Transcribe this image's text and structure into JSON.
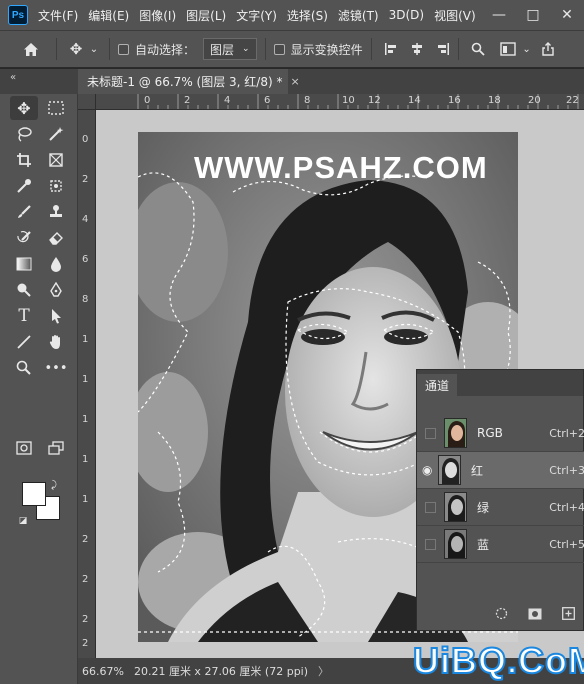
{
  "menu": {
    "logo": "Ps",
    "items": [
      "文件(F)",
      "编辑(E)",
      "图像(I)",
      "图层(L)",
      "文字(Y)",
      "选择(S)",
      "滤镜(T)",
      "3D(D)",
      "视图(V)"
    ]
  },
  "window_controls": {
    "minimize": "—",
    "maximize": "□",
    "close": "✕"
  },
  "options": {
    "auto_select_label": "自动选择：",
    "auto_select_value": "图层",
    "show_transform_label": "显示变换控件"
  },
  "tab": {
    "collapse": "«",
    "title": "未标题-1 @ 66.7% (图层 3, 红/8) *",
    "close": "×"
  },
  "ruler_top": [
    "0",
    "2",
    "4",
    "6",
    "8",
    "10",
    "12",
    "14",
    "16",
    "18",
    "20",
    "22"
  ],
  "ruler_left": [
    "0",
    "2",
    "4",
    "6",
    "8",
    "1",
    "1",
    "1",
    "1",
    "1",
    "2",
    "2",
    "2",
    "2"
  ],
  "canvas": {
    "watermark": "WWW.PSAHZ.COM"
  },
  "status": {
    "zoom": "66.67%",
    "doc_info": "20.21 厘米 x 27.06 厘米 (72 ppi)",
    "arrow": "〉"
  },
  "channels_panel": {
    "tab": "通道",
    "channels": [
      {
        "name": "RGB",
        "shortcut": "Ctrl+2",
        "visible": false
      },
      {
        "name": "红",
        "shortcut": "Ctrl+3",
        "visible": true
      },
      {
        "name": "绿",
        "shortcut": "Ctrl+4",
        "visible": false
      },
      {
        "name": "蓝",
        "shortcut": "Ctrl+5",
        "visible": false
      }
    ]
  },
  "brand": "UiBQ.CoM",
  "colors": {
    "accent": "#31a8ff",
    "panel": "#535353",
    "canvas_bg": "#c9c9c9"
  }
}
